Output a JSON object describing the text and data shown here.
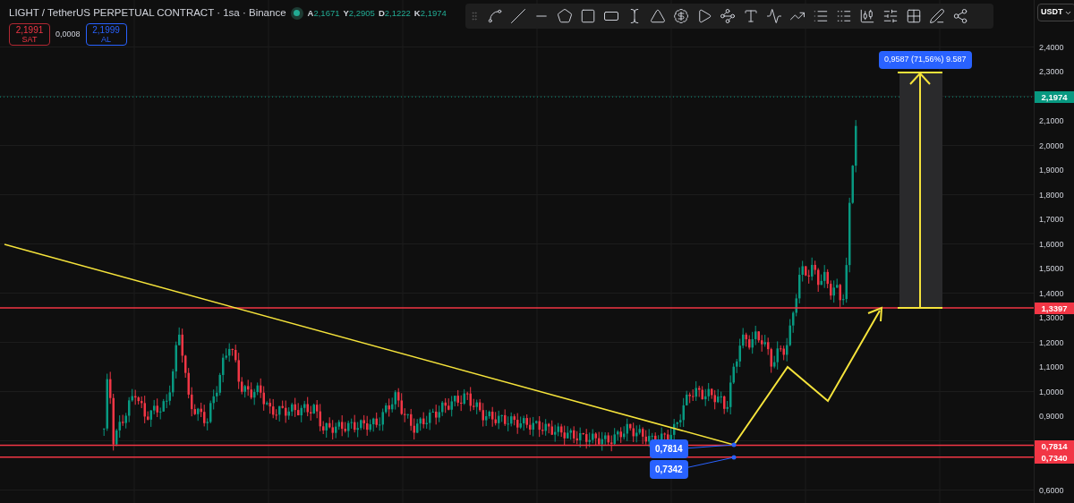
{
  "header": {
    "title": "LIGHT / TetherUS PERPETUAL CONTRACT · 1sa · Binance",
    "market_open": true,
    "ohlc": [
      {
        "label": "A",
        "value": "2,1671"
      },
      {
        "label": "Y",
        "value": "2,2905"
      },
      {
        "label": "D",
        "value": "2,1222"
      },
      {
        "label": "K",
        "value": "2,1974"
      }
    ],
    "sell": {
      "price": "2,1991",
      "label": "SAT"
    },
    "spread": "0,0008",
    "buy": {
      "price": "2,1999",
      "label": "AL"
    }
  },
  "currency": "USDT",
  "price_axis": {
    "ticks": [
      "2,4000",
      "2,3000",
      "2,1000",
      "2,0000",
      "1,9000",
      "1,8000",
      "1,7000",
      "1,6000",
      "1,5000",
      "1,4000",
      "1,3000",
      "1,2000",
      "1,1000",
      "1,0000",
      "0,9000",
      "0,6000"
    ]
  },
  "price_lines": [
    {
      "price": "2,1974",
      "kind": "last",
      "color": "#089981"
    },
    {
      "price": "1,3397",
      "kind": "level",
      "color": "#f23645"
    },
    {
      "price": "0,7814",
      "kind": "level",
      "color": "#f23645"
    },
    {
      "price": "0,7340",
      "kind": "level",
      "color": "#f23645"
    }
  ],
  "annotations": {
    "measure": "0,9587 (71,56%) 9.587",
    "points": [
      "0,7814",
      "0,7342"
    ]
  }
}
